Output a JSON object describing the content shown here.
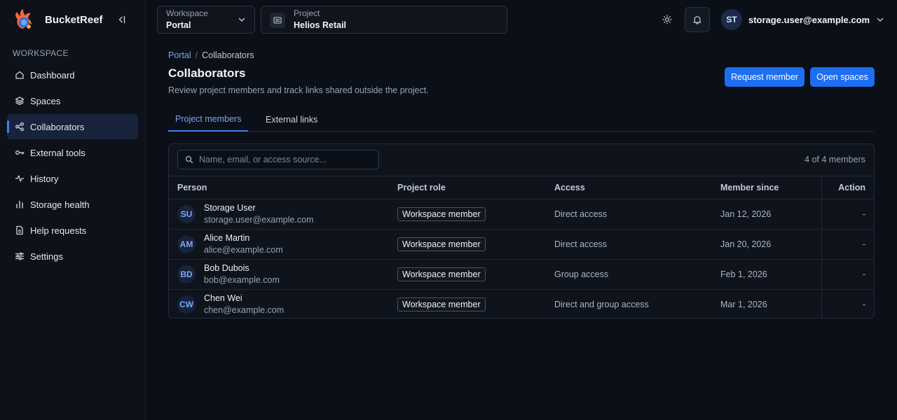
{
  "app": {
    "name": "BucketReef"
  },
  "sidebar": {
    "section_label": "WORKSPACE",
    "items": [
      {
        "label": "Dashboard",
        "icon": "home-icon",
        "active": false
      },
      {
        "label": "Spaces",
        "icon": "layers-icon",
        "active": false
      },
      {
        "label": "Collaborators",
        "icon": "share-icon",
        "active": true
      },
      {
        "label": "External tools",
        "icon": "key-icon",
        "active": false
      },
      {
        "label": "History",
        "icon": "activity-icon",
        "active": false
      },
      {
        "label": "Storage health",
        "icon": "bar-chart-icon",
        "active": false
      },
      {
        "label": "Help requests",
        "icon": "file-text-icon",
        "active": false
      },
      {
        "label": "Settings",
        "icon": "sliders-icon",
        "active": false
      }
    ]
  },
  "topbar": {
    "workspace": {
      "label": "Workspace",
      "value": "Portal"
    },
    "project": {
      "label": "Project",
      "value": "Helios Retail"
    },
    "user": {
      "initials": "ST",
      "email": "storage.user@example.com"
    }
  },
  "breadcrumb": {
    "root": "Portal",
    "separator": "/",
    "current": "Collaborators"
  },
  "page": {
    "title": "Collaborators",
    "description": "Review project members and track links shared outside the project.",
    "actions": {
      "request_member": "Request member",
      "open_spaces": "Open spaces"
    }
  },
  "tabs": [
    {
      "label": "Project members",
      "active": true
    },
    {
      "label": "External links",
      "active": false
    }
  ],
  "members": {
    "search_placeholder": "Name, email, or access source...",
    "count": "4 of 4 members",
    "columns": {
      "person": "Person",
      "role": "Project role",
      "access": "Access",
      "since": "Member since",
      "action": "Action"
    },
    "rows": [
      {
        "initials": "SU",
        "name": "Storage User",
        "email": "storage.user@example.com",
        "role": "Workspace member",
        "access": "Direct access",
        "since": "Jan 12, 2026",
        "action": "-"
      },
      {
        "initials": "AM",
        "name": "Alice Martin",
        "email": "alice@example.com",
        "role": "Workspace member",
        "access": "Direct access",
        "since": "Jan 20, 2026",
        "action": "-"
      },
      {
        "initials": "BD",
        "name": "Bob Dubois",
        "email": "bob@example.com",
        "role": "Workspace member",
        "access": "Group access",
        "since": "Feb 1, 2026",
        "action": "-"
      },
      {
        "initials": "CW",
        "name": "Chen Wei",
        "email": "chen@example.com",
        "role": "Workspace member",
        "access": "Direct and group access",
        "since": "Mar 1, 2026",
        "action": "-"
      }
    ]
  },
  "colors": {
    "accent": "#3b82f6",
    "button": "#1d6ef0",
    "background": "#0b0f17",
    "sidebar_bg": "#0d1119"
  }
}
